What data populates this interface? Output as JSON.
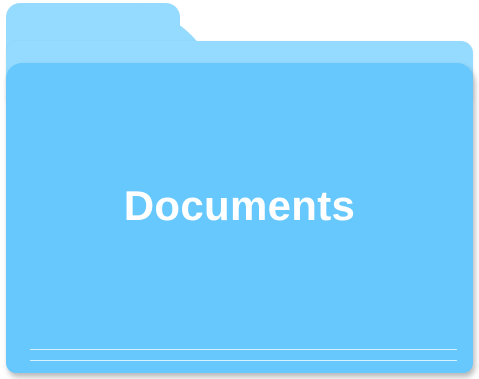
{
  "folder": {
    "label": "Documents",
    "colors": {
      "tab": "#95daff",
      "front": "#66c8fc",
      "label_text": "#ffffff"
    },
    "icon": "folder-icon"
  }
}
